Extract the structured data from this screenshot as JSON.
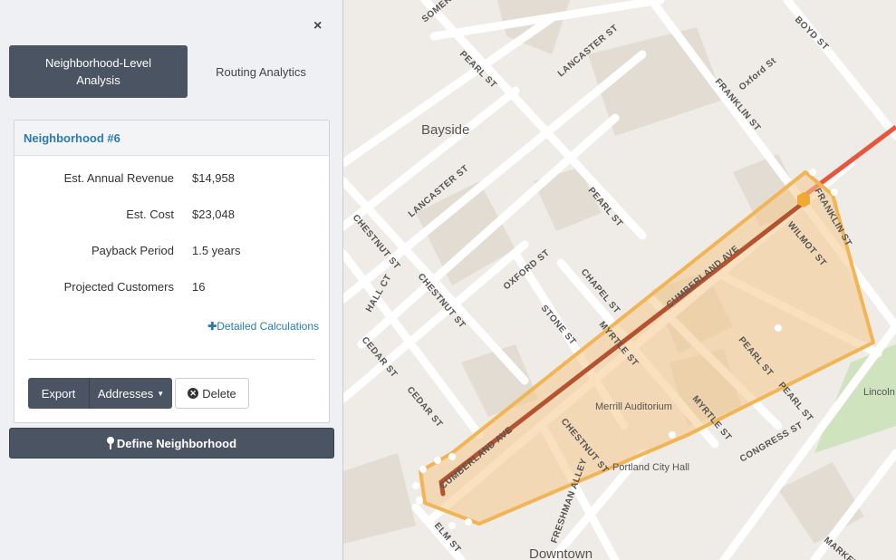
{
  "panel": {
    "close_symbol": "×",
    "tabs": [
      {
        "label": "Neighborhood-Level Analysis",
        "active": true
      },
      {
        "label": "Routing Analytics",
        "active": false
      }
    ],
    "card": {
      "title": "Neighborhood #6",
      "stats": [
        {
          "label": "Est. Annual Revenue",
          "value": "$14,958"
        },
        {
          "label": "Est. Cost",
          "value": "$23,048"
        },
        {
          "label": "Payback Period",
          "value": "1.5 years"
        },
        {
          "label": "Projected Customers",
          "value": "16"
        }
      ],
      "details_link": "Detailed Calculations",
      "export_label": "Export",
      "addresses_label": "Addresses",
      "delete_label": "Delete"
    },
    "define_label": "Define Neighborhood"
  },
  "map": {
    "areas": [
      "Bayside",
      "Downtown"
    ],
    "pois": [
      "Merrill Auditorium",
      "Portland City Hall",
      "Lincoln"
    ],
    "streets": [
      "SOMERSET ST",
      "LANCASTER ST",
      "PEARL ST",
      "BOYD ST",
      "Oxford St",
      "FRANKLIN ST",
      "CHESTNUT ST",
      "HALL CT",
      "CEDAR ST",
      "OXFORD ST",
      "CHAPEL ST",
      "STONE ST",
      "MYRTLE ST",
      "CUMBERLAND AVE",
      "WILMOT ST",
      "CONGRESS ST",
      "FRESHMAN ALLEY",
      "ELM ST",
      "MARKET ST"
    ],
    "colors": {
      "polygon_stroke": "#f2b556",
      "polygon_fill": "#f4c98a",
      "route": "#b5532f",
      "highway": "#e8553f",
      "park": "#cfe3be"
    }
  }
}
